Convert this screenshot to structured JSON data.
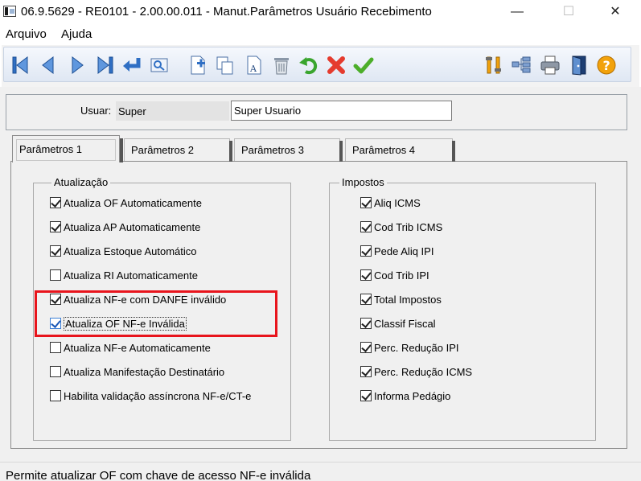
{
  "window": {
    "title": "06.9.5629 - RE0101 - 2.00.00.011 - Manut.Parâmetros Usuário Recebimento",
    "minimize": "—",
    "maximize": "☐",
    "close": "✕"
  },
  "menu": {
    "file": "Arquivo",
    "help": "Ajuda"
  },
  "toolbar": {
    "icons": [
      "first-record-icon",
      "previous-record-icon",
      "next-record-icon",
      "last-record-icon",
      "go-to-record-icon",
      "search-record-icon",
      "new-record-icon",
      "copy-record-icon",
      "edit-record-icon",
      "delete-record-icon",
      "undo-icon",
      "cancel-icon",
      "confirm-icon",
      "tools-icon",
      "hierarchy-icon",
      "print-icon",
      "exit-icon",
      "help-icon"
    ]
  },
  "user": {
    "label": "Usuar:",
    "code": "Super",
    "name": "Super Usuario"
  },
  "tabs": [
    {
      "label": "Parâmetros 1",
      "selected": true
    },
    {
      "label": "Parâmetros 2",
      "selected": false
    },
    {
      "label": "Parâmetros 3",
      "selected": false
    },
    {
      "label": "Parâmetros 4",
      "selected": false
    }
  ],
  "atualizacao": {
    "title": "Atualização",
    "items": [
      {
        "label": "Atualiza OF Automaticamente",
        "checked": true
      },
      {
        "label": "Atualiza AP Automaticamente",
        "checked": true
      },
      {
        "label": "Atualiza Estoque Automático",
        "checked": true
      },
      {
        "label": "Atualiza RI Automaticamente",
        "checked": false
      },
      {
        "label": "Atualiza NF-e com DANFE inválido",
        "checked": true
      },
      {
        "label": "Atualiza OF NF-e Inválida",
        "checked": true
      },
      {
        "label": "Atualiza NF-e Automaticamente",
        "checked": false
      },
      {
        "label": "Atualiza Manifestação Destinatário",
        "checked": false
      },
      {
        "label": "Habilita validação assíncrona NF-e/CT-e",
        "checked": false
      }
    ]
  },
  "impostos": {
    "title": "Impostos",
    "items": [
      {
        "label": "Aliq ICMS",
        "checked": true
      },
      {
        "label": "Cod Trib ICMS",
        "checked": true
      },
      {
        "label": "Pede Aliq IPI",
        "checked": true
      },
      {
        "label": "Cod Trib IPI",
        "checked": true
      },
      {
        "label": "Total Impostos",
        "checked": true
      },
      {
        "label": "Classif Fiscal",
        "checked": true
      },
      {
        "label": "Perc. Redução IPI",
        "checked": true
      },
      {
        "label": "Perc. Redução ICMS",
        "checked": true
      },
      {
        "label": "Informa Pedágio",
        "checked": true
      }
    ]
  },
  "status": {
    "text": "Permite atualizar OF com chave de acesso NF-e inválida"
  },
  "colors": {
    "highlight": "#e8141c",
    "toolbar_blue": "#2f6fc4",
    "undo_green": "#3aa52e",
    "cancel_red": "#e53b2e",
    "help_orange": "#f2a20c"
  }
}
